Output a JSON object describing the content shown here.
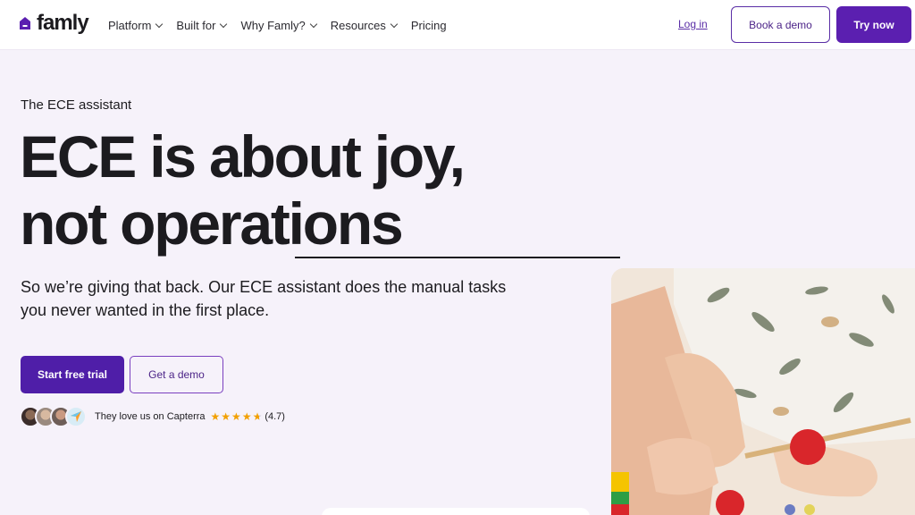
{
  "nav": {
    "logo_text": "famly",
    "menu": [
      {
        "label": "Platform",
        "dropdown": true
      },
      {
        "label": "Built for",
        "dropdown": true
      },
      {
        "label": "Why Famly?",
        "dropdown": true
      },
      {
        "label": "Resources",
        "dropdown": true
      },
      {
        "label": "Pricing",
        "dropdown": false
      }
    ],
    "login_label": "Log in",
    "book_demo_label": "Book a demo",
    "try_now_label": "Try now"
  },
  "hero": {
    "eyebrow": "The ECE assistant",
    "headline_line1": "ECE is about joy,",
    "headline_line2": "not operations",
    "subtext": "So we’re giving that back. Our ECE assistant does the manual tasks you never wanted in the first place.",
    "primary_cta": "Start free trial",
    "secondary_cta": "Get a demo",
    "social_proof": {
      "text": "They love us on Capterra",
      "rating": "(4.7)",
      "stars": 4.7
    }
  },
  "colors": {
    "brand_purple": "#5b1fb0",
    "background": "#f6f2fa",
    "star": "#f2a000"
  },
  "icons": [
    "famly-house-logo-icon",
    "chevron-down-icon",
    "star-icon",
    "capterra-arrow-icon"
  ]
}
